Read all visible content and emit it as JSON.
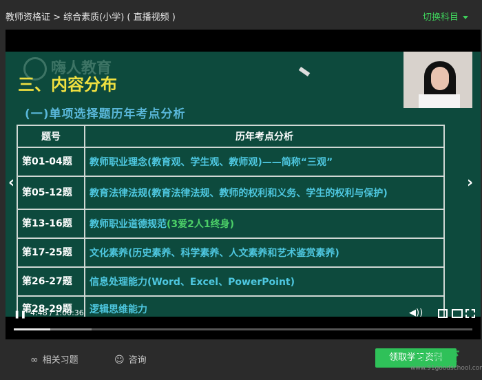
{
  "header": {
    "breadcrumb": "教师资格证 > 综合素质(小学) ( 直播视频 )",
    "switch_subject": "切换科目"
  },
  "slide": {
    "logo_text": "嗨人教育",
    "heading": "三、内容分布",
    "subheading": "(一)单项选择题历年考点分析",
    "table_headers": [
      "题号",
      "历年考点分析"
    ],
    "rows": [
      {
        "num": "第01-04题",
        "desc": "教师职业理念(教育观、学生观、教师观)——简称“三观”"
      },
      {
        "num": "第05-12题",
        "desc": "教育法律法规(教育法律法规、教师的权利和义务、学生的权利与保护)"
      },
      {
        "num": "第13-16题",
        "desc": "教师职业道德规范",
        "accent": "(3爱2人1终身)"
      },
      {
        "num": "第17-25题",
        "desc": "文化素养(历史素养、科学素养、人文素养和艺术鉴赏素养)"
      },
      {
        "num": "第26-27题",
        "desc": "信息处理能力(Word、Excel、PowerPoint)"
      },
      {
        "num": "第28-29题",
        "desc": "逻辑思维能力"
      }
    ]
  },
  "controls": {
    "play_icon": "pause-icon",
    "time": "4:48 / 1:00:36",
    "progress_fraction": 0.08,
    "buffer_fraction": 0.17
  },
  "bottom": {
    "related_exercises": "相关习题",
    "consult": "咨询",
    "get_materials": "领取学习资料",
    "watermark": "好学校",
    "watermark_url": "www.91goodschool.com"
  },
  "colors": {
    "accent_green": "#2fc159",
    "slide_bg": "#0d4a3d",
    "heading_yellow": "#f0e040",
    "table_text": "#4ec7e0"
  }
}
